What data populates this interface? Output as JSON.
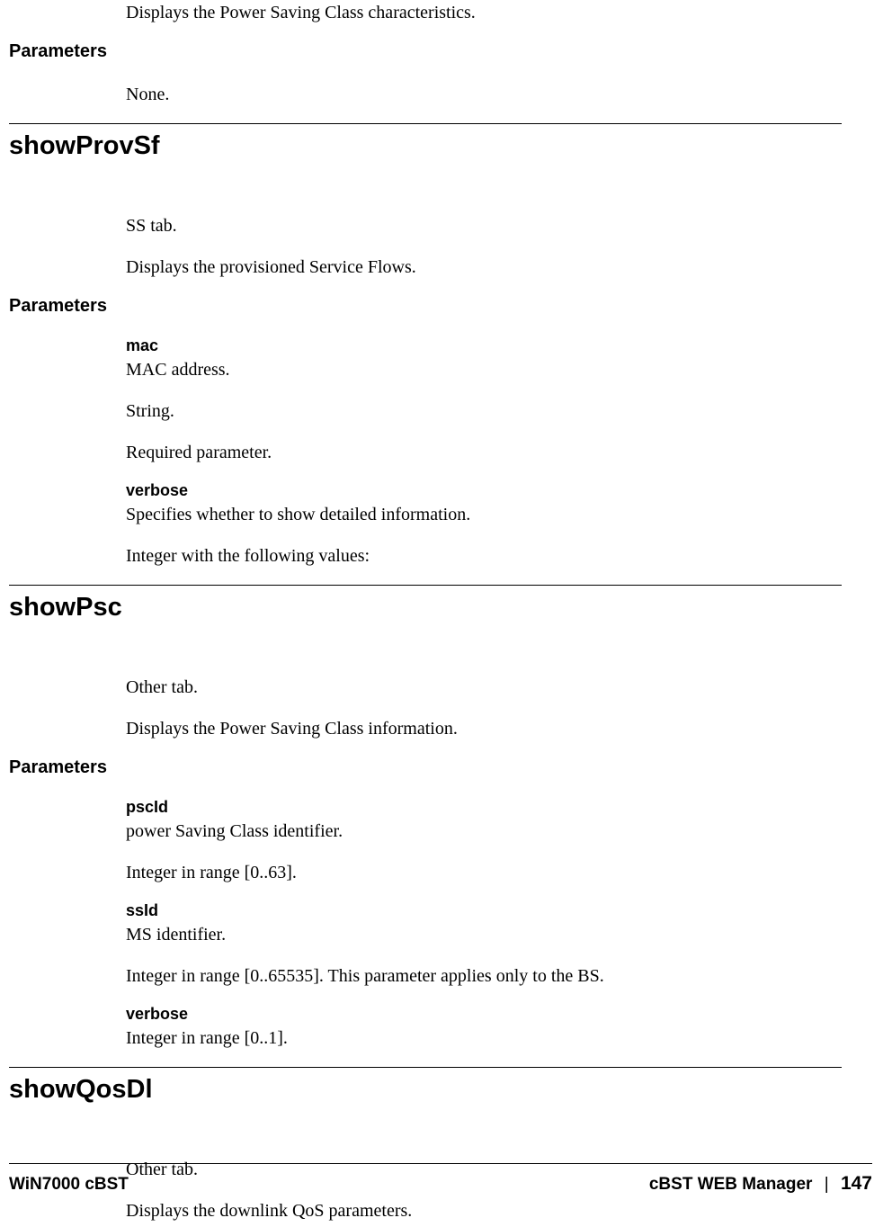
{
  "intro": {
    "desc": "Displays the Power Saving Class characteristics.",
    "paramsHeading": "Parameters",
    "paramsText": "None."
  },
  "sec1": {
    "title": "showProvSf",
    "tab": "SS tab.",
    "desc": "Displays the provisioned Service Flows.",
    "paramsHeading": "Parameters",
    "p1": {
      "name": "mac",
      "l1": "MAC address.",
      "l2": "String.",
      "l3": "Required parameter."
    },
    "p2": {
      "name": "verbose",
      "l1": "Specifies whether to show detailed information.",
      "l2": "Integer with the following values:"
    }
  },
  "sec2": {
    "title": "showPsc",
    "tab": "Other tab.",
    "desc": "Displays the Power Saving Class information.",
    "paramsHeading": "Parameters",
    "p1": {
      "name": "pscId",
      "l1": "power Saving Class identifier.",
      "l2": "Integer in range [0..63]."
    },
    "p2": {
      "name": "ssId",
      "l1": "MS identifier.",
      "l2": "Integer in range [0..65535]. This parameter applies only to the BS."
    },
    "p3": {
      "name": "verbose",
      "l1": "Integer in range [0..1]."
    }
  },
  "sec3": {
    "title": "showQosDl",
    "tab": "Other tab.",
    "desc": "Displays the downlink QoS parameters."
  },
  "footer": {
    "left": "WiN7000 cBST",
    "rightTitle": "cBST WEB Manager",
    "sep": "|",
    "page": "147"
  }
}
